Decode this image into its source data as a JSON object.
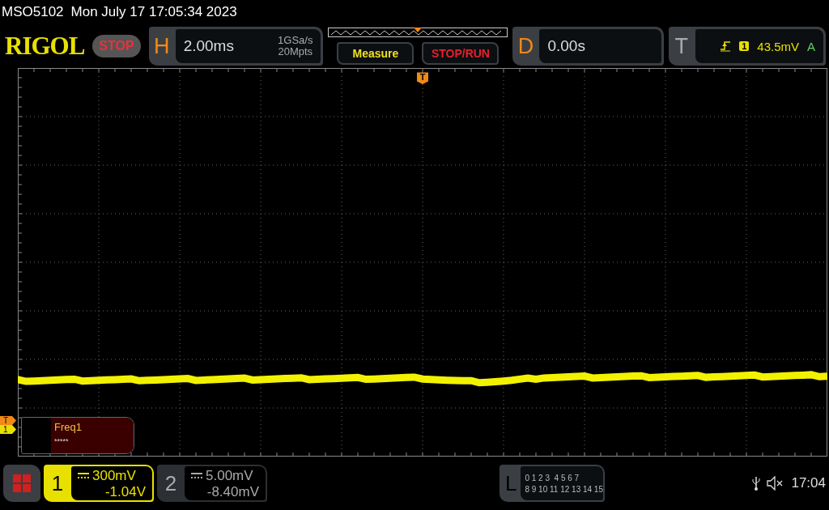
{
  "status_line": {
    "model": "MSO5102",
    "datetime": "Mon July 17 17:05:34 2023"
  },
  "toolbar": {
    "logo": "RIGOL",
    "run_state": "STOP",
    "horizontal": {
      "label": "H",
      "timebase": "2.00ms",
      "sample_rate": "1GSa/s",
      "memory_depth": "20Mpts"
    },
    "buttons": [
      {
        "label": "Measure",
        "kind": "measure"
      },
      {
        "label": "STOP/RUN",
        "kind": "run"
      }
    ],
    "delay": {
      "label": "D",
      "value": "0.00s"
    },
    "trigger": {
      "label": "T",
      "source": "1",
      "level": "43.5mV",
      "mode": "A"
    }
  },
  "waveform": {
    "trigger_marker": "T",
    "left_markers": [
      {
        "label": "T",
        "kind": "trigger"
      },
      {
        "label": "1",
        "kind": "channel"
      }
    ]
  },
  "measurement": {
    "name": "Freq1",
    "value": "*****"
  },
  "channels": [
    {
      "number": "1",
      "selected": true,
      "scale": "300mV",
      "offset": "-1.04V"
    },
    {
      "number": "2",
      "selected": false,
      "scale": "5.00mV",
      "offset": "-8.40mV"
    }
  ],
  "logic": {
    "label": "L",
    "rows": [
      "0 1 2 3  4 5 6 7",
      "8 9 10 11 12 13 14 15"
    ]
  },
  "status_tray": {
    "time": "17:04"
  }
}
